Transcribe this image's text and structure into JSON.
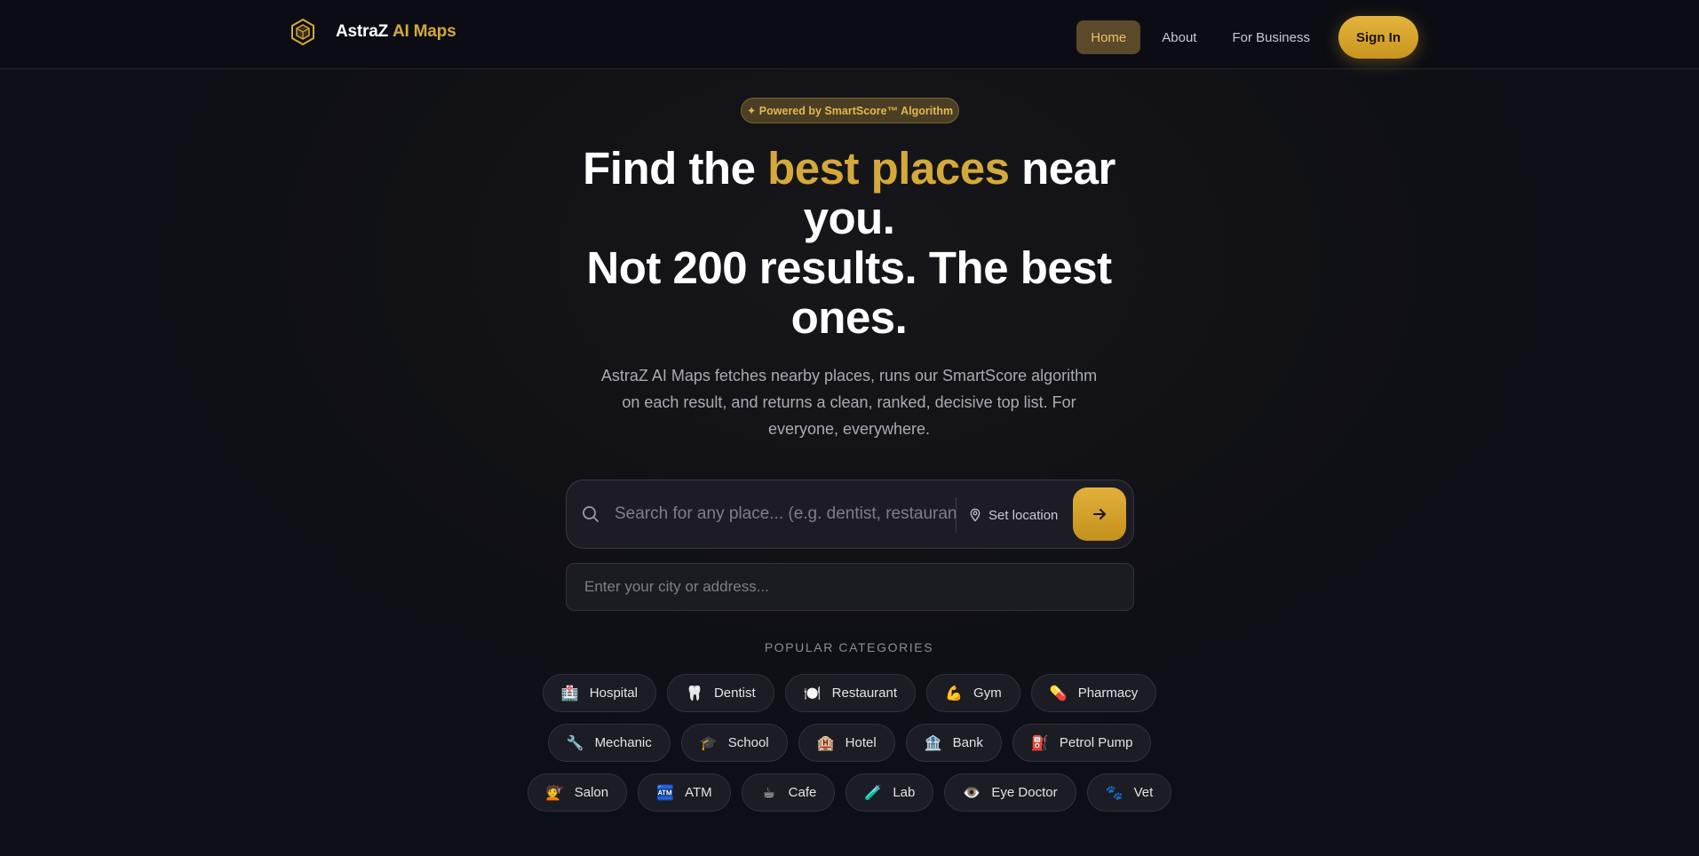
{
  "brand": {
    "name": "AstraZ",
    "accent": "AI Maps",
    "accent_color": "#d4a93b",
    "logo_icon": "hexagon-cube-icon"
  },
  "nav": {
    "items": [
      {
        "label": "Home",
        "active": true
      },
      {
        "label": "About",
        "active": false
      },
      {
        "label": "For Business",
        "active": false
      }
    ],
    "signin_label": "Sign In"
  },
  "hero": {
    "badge": "✦ Powered by SmartScore™ Algorithm",
    "headline_pre": "Find the ",
    "headline_gold": "best places",
    "headline_post": " near you.",
    "headline_line2": "Not 200 results. The best ones.",
    "subtext": "AstraZ AI Maps fetches nearby places, runs our SmartScore algorithm on each result, and returns a clean, ranked, decisive top list. For everyone, everywhere."
  },
  "search": {
    "placeholder": "Search for any place... (e.g. dentist, restaurant, gym)",
    "value": "",
    "set_location_label": "Set location",
    "go_icon": "arrow-right-icon",
    "city_placeholder": "Enter your city or address..."
  },
  "categories": {
    "heading": "POPULAR CATEGORIES",
    "rows": [
      [
        {
          "label": "Hospital",
          "icon": "🏥",
          "name": "hospital"
        },
        {
          "label": "Dentist",
          "icon": "🦷",
          "name": "dentist"
        },
        {
          "label": "Restaurant",
          "icon": "🍽️",
          "name": "restaurant"
        },
        {
          "label": "Gym",
          "icon": "💪",
          "name": "gym"
        },
        {
          "label": "Pharmacy",
          "icon": "💊",
          "name": "pharmacy"
        }
      ],
      [
        {
          "label": "Mechanic",
          "icon": "🔧",
          "name": "mechanic"
        },
        {
          "label": "School",
          "icon": "🎓",
          "name": "school"
        },
        {
          "label": "Hotel",
          "icon": "🏨",
          "name": "hotel"
        },
        {
          "label": "Bank",
          "icon": "🏦",
          "name": "bank"
        },
        {
          "label": "Petrol Pump",
          "icon": "⛽",
          "name": "petrol-pump"
        }
      ],
      [
        {
          "label": "Salon",
          "icon": "💇",
          "name": "salon"
        },
        {
          "label": "ATM",
          "icon": "🏧",
          "name": "atm"
        },
        {
          "label": "Cafe",
          "icon": "☕",
          "name": "cafe"
        },
        {
          "label": "Lab",
          "icon": "🧪",
          "name": "lab"
        },
        {
          "label": "Eye Doctor",
          "icon": "👁️",
          "name": "eye-doctor"
        },
        {
          "label": "Vet",
          "icon": "🐾",
          "name": "vet"
        }
      ]
    ]
  }
}
